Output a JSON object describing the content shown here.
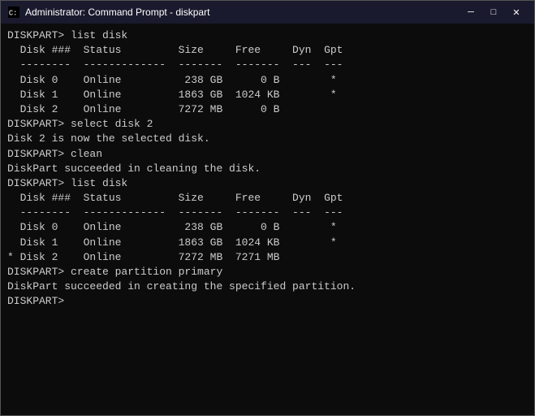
{
  "titleBar": {
    "icon": "cmd-icon",
    "title": "Administrator: Command Prompt - diskpart",
    "minimizeLabel": "─",
    "maximizeLabel": "□",
    "closeLabel": "✕"
  },
  "console": {
    "lines": [
      "DISKPART> list disk",
      "",
      "  Disk ###  Status         Size     Free     Dyn  Gpt",
      "  --------  -------------  -------  -------  ---  ---",
      "  Disk 0    Online          238 GB      0 B        *",
      "  Disk 1    Online         1863 GB  1024 KB        *",
      "  Disk 2    Online         7272 MB      0 B",
      "",
      "DISKPART> select disk 2",
      "",
      "Disk 2 is now the selected disk.",
      "",
      "DISKPART> clean",
      "",
      "DiskPart succeeded in cleaning the disk.",
      "",
      "DISKPART> list disk",
      "",
      "  Disk ###  Status         Size     Free     Dyn  Gpt",
      "  --------  -------------  -------  -------  ---  ---",
      "  Disk 0    Online          238 GB      0 B        *",
      "  Disk 1    Online         1863 GB  1024 KB        *",
      "* Disk 2    Online         7272 MB  7271 MB",
      "",
      "DISKPART> create partition primary",
      "",
      "DiskPart succeeded in creating the specified partition.",
      "",
      "DISKPART> "
    ]
  }
}
